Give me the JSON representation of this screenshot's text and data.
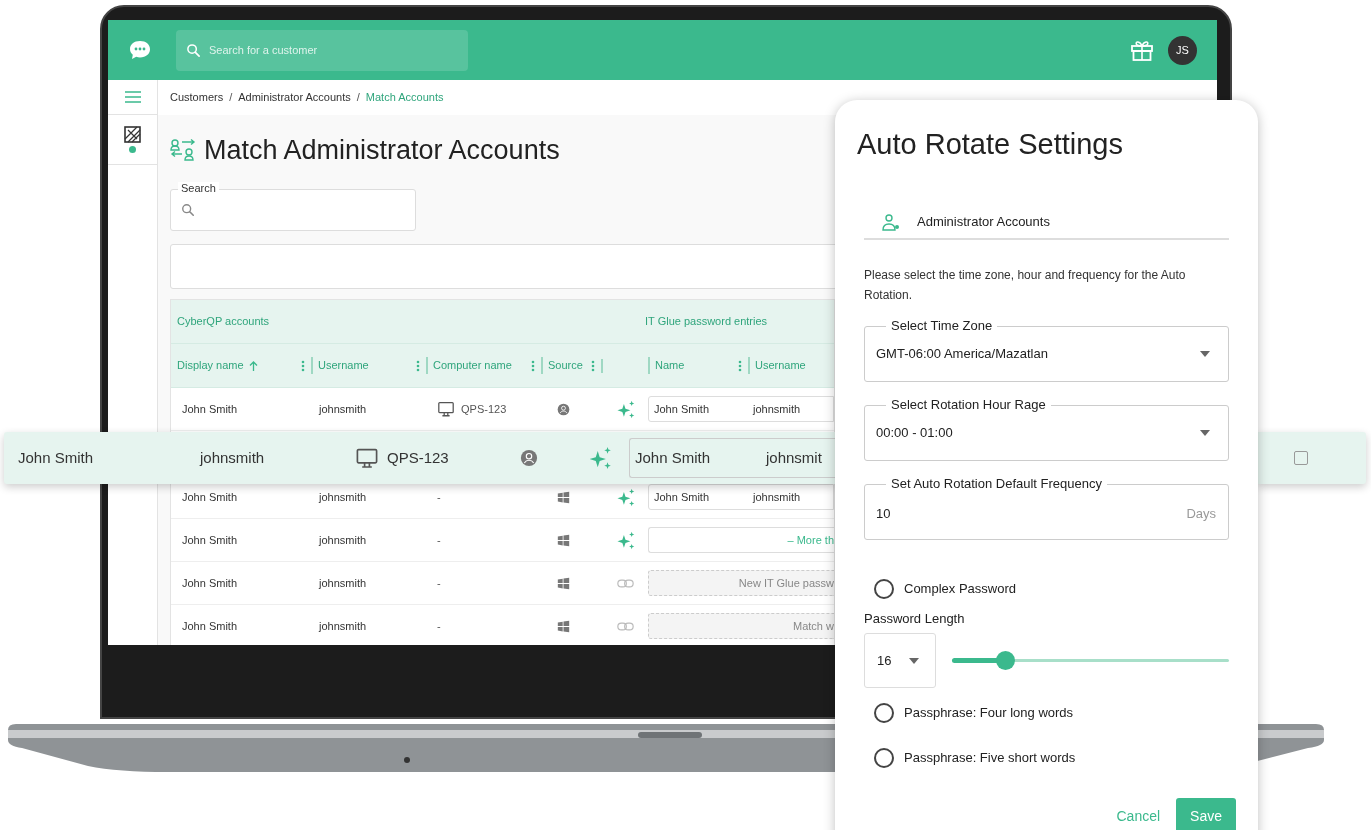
{
  "header": {
    "search_placeholder": "Search for a customer",
    "avatar_initials": "JS"
  },
  "breadcrumb_separator": "/",
  "breadcrumbs": [
    {
      "label": "Customers",
      "selected": false
    },
    {
      "label": "Administrator Accounts",
      "selected": false
    },
    {
      "label": "Match Accounts",
      "selected": true
    }
  ],
  "page_title": "Match Administrator Accounts",
  "search": {
    "label": "Search"
  },
  "table": {
    "groups": [
      "CyberQP accounts",
      "IT Glue password entries"
    ],
    "columns": [
      {
        "label": "Display name",
        "sorted": true
      },
      {
        "label": "Username",
        "sorted": false
      },
      {
        "label": "Computer name",
        "sorted": false
      },
      {
        "label": "Source",
        "sorted": false
      },
      {
        "label": "Name",
        "sorted": false
      },
      {
        "label": "Username",
        "sorted": false
      }
    ],
    "rows": [
      {
        "display_name": "John Smith",
        "username": "johnsmith",
        "computer": "QPS-123",
        "computer_icon": true,
        "source": {
          "kind": "user"
        },
        "action": {
          "kind": "sparkle"
        },
        "entry": {
          "kind": "pair",
          "name": "John Smith",
          "username": "johnsmith"
        }
      },
      {
        "display_name": "John Smith",
        "username": "johnsmith",
        "computer": "-",
        "computer_icon": false,
        "source": {
          "kind": "windows"
        },
        "action": {
          "kind": "sparkle"
        },
        "entry": {
          "kind": "pair",
          "name": "John Smith",
          "username": "johnsmith"
        }
      },
      {
        "display_name": "John Smith",
        "username": "johnsmith",
        "computer": "-",
        "computer_icon": false,
        "source": {
          "kind": "windows"
        },
        "action": {
          "kind": "sparkle"
        },
        "entry": {
          "kind": "more",
          "text": "– More th"
        }
      },
      {
        "display_name": "John Smith",
        "username": "johnsmith",
        "computer": "-",
        "computer_icon": false,
        "source": {
          "kind": "windows"
        },
        "action": {
          "kind": "link"
        },
        "entry": {
          "kind": "placeholder",
          "text": "New IT Glue passw"
        }
      },
      {
        "display_name": "John Smith",
        "username": "johnsmith",
        "computer": "-",
        "computer_icon": false,
        "source": {
          "kind": "windows"
        },
        "action": {
          "kind": "link"
        },
        "entry": {
          "kind": "placeholder",
          "text": "Match w"
        }
      }
    ]
  },
  "highlighted_row": {
    "display_name": "John Smith",
    "username": "johnsmith",
    "computer": "QPS-123",
    "source": {
      "kind": "user"
    },
    "action": {
      "kind": "sparkle"
    },
    "entry_name": "John Smith",
    "entry_username": "johnsmit",
    "checked": false
  },
  "settings_panel": {
    "title": "Auto Rotate Settings",
    "tab": "Administrator Accounts",
    "description": "Please select the time zone, hour and frequency for the Auto Rotation.",
    "fields": [
      {
        "kind": "select",
        "label": "Select Time Zone",
        "value": "GMT-06:00 America/Mazatlan"
      },
      {
        "kind": "select",
        "label": "Select Rotation Hour Rage",
        "value": "00:00 - 01:00"
      },
      {
        "kind": "number",
        "label": "Set Auto Rotation Default Frequency",
        "value": "10",
        "suffix": "Days"
      }
    ],
    "options": [
      {
        "kind": "radio",
        "label": "Complex Password",
        "selected": false
      },
      {
        "kind": "length",
        "label": "Password Length",
        "value": "16",
        "level": 0.17
      },
      {
        "kind": "radio",
        "label": "Passphrase: Four long words",
        "selected": false
      },
      {
        "kind": "radio",
        "label": "Passphrase: Five short words",
        "selected": false
      }
    ],
    "buttons": [
      {
        "kind": "text",
        "label": "Cancel"
      },
      {
        "kind": "primary",
        "label": "Save"
      }
    ]
  }
}
